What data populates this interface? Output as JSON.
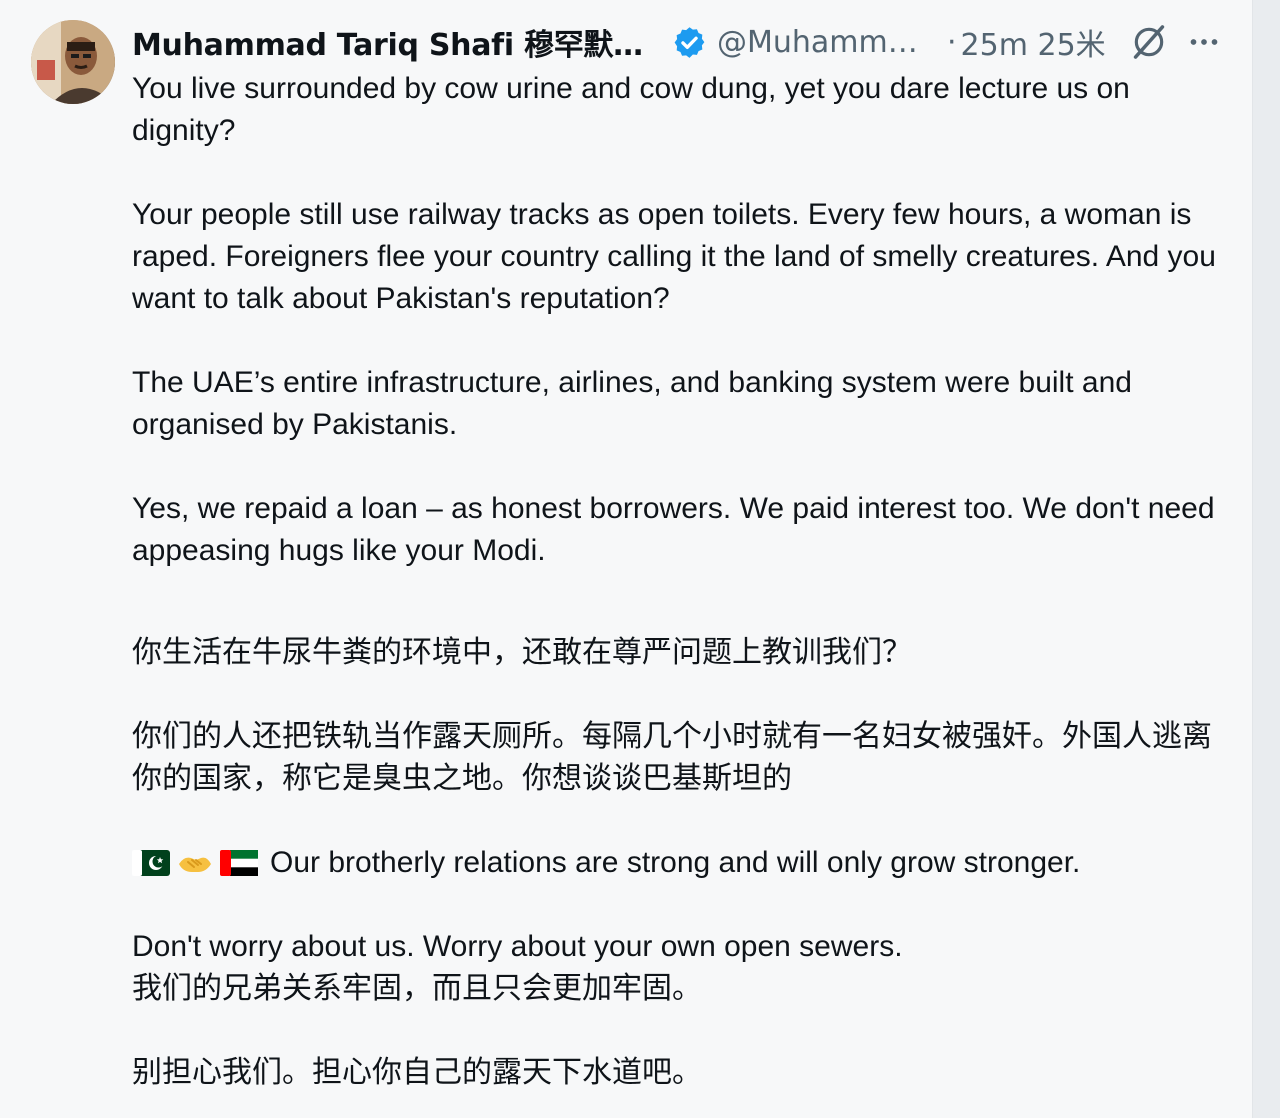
{
  "post": {
    "author": {
      "display_name": "Muhammad Tariq Shafi 穆罕默德·...",
      "handle": "@Muhamma...",
      "verified": true
    },
    "separator": "·",
    "timestamp": "25m 25米",
    "icons": {
      "avatar": "profile-photo",
      "verified": "verified-badge-icon",
      "grok": "grok-icon",
      "more": "more-options-icon",
      "flag_pk": "pakistan-flag-icon",
      "handshake": "handshake-icon",
      "flag_ae": "uae-flag-icon"
    },
    "colors": {
      "verified_blue": "#1d9bf0",
      "text": "#0f1419",
      "secondary_text": "#536471",
      "background": "#f7f8f9"
    },
    "paragraphs": {
      "p1": "You live surrounded by cow urine and cow dung, yet you dare lecture us on dignity?",
      "p2": "Your people still use railway tracks as open toilets. Every few hours, a woman is raped. Foreigners flee your country calling it the land of smelly creatures. And you want to talk about Pakistan's reputation?",
      "p3": "The UAE’s entire infrastructure, airlines, and banking system were built and organised by Pakistanis.",
      "p4": "Yes, we repaid a loan – as honest borrowers. We paid interest too. We don't need appeasing hugs like your Modi.",
      "zh1": "你生活在牛尿牛粪的环境中，还敢在尊严问题上教训我们？",
      "zh2": "你们的人还把铁轨当作露天厕所。每隔几个小时就有一名妇女被强奸。外国人逃离你的国家，称它是臭虫之地。你想谈谈巴基斯坦的",
      "emoji_line": "Our brotherly relations are strong and will only grow stronger.",
      "p5": "Don't worry about us. Worry about your own open sewers.",
      "zh3": "我们的兄弟关系牢固，而且只会更加牢固。",
      "zh4": "别担心我们。担心你自己的露天下水道吧。"
    }
  }
}
